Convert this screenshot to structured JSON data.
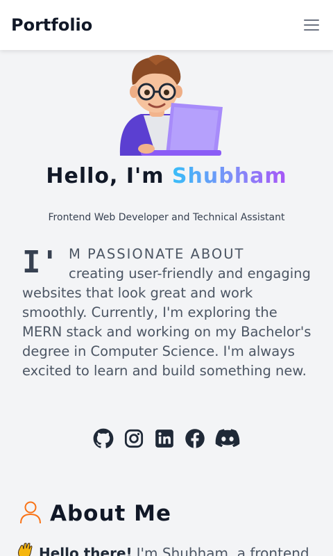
{
  "navbar": {
    "brand": "Portfolio",
    "menu_icon": "hamburger-menu-icon"
  },
  "hero": {
    "greeting_prefix": "Hello, I'm ",
    "name": "Shubham",
    "subtitle": "Frontend Web Developer and Technical Assistant",
    "avatar_icon": "developer-with-laptop-avatar"
  },
  "intro": {
    "dropcap": "I'",
    "lead": "m passionate about",
    "body": "creating user-friendly and engaging websites that look great and work smoothly. Currently, I'm exploring the MERN stack and working on my Bachelor's degree in Computer Science. I'm always excited to learn and build something new."
  },
  "socials": [
    {
      "name": "GitHub",
      "icon": "github-icon"
    },
    {
      "name": "Instagram",
      "icon": "instagram-icon"
    },
    {
      "name": "LinkedIn",
      "icon": "linkedin-icon"
    },
    {
      "name": "Facebook",
      "icon": "facebook-icon"
    },
    {
      "name": "Discord",
      "icon": "discord-icon"
    }
  ],
  "about": {
    "title": "About Me",
    "hello_strong": "Hello there!",
    "hello_text": "I'm Shubham, a frontend"
  },
  "colors": {
    "accent_gradient": [
      "#38bdf8",
      "#818cf8",
      "#a855f7"
    ],
    "user_icon": "#f97316",
    "text_dark": "#111827",
    "text_muted": "#4b5563"
  }
}
